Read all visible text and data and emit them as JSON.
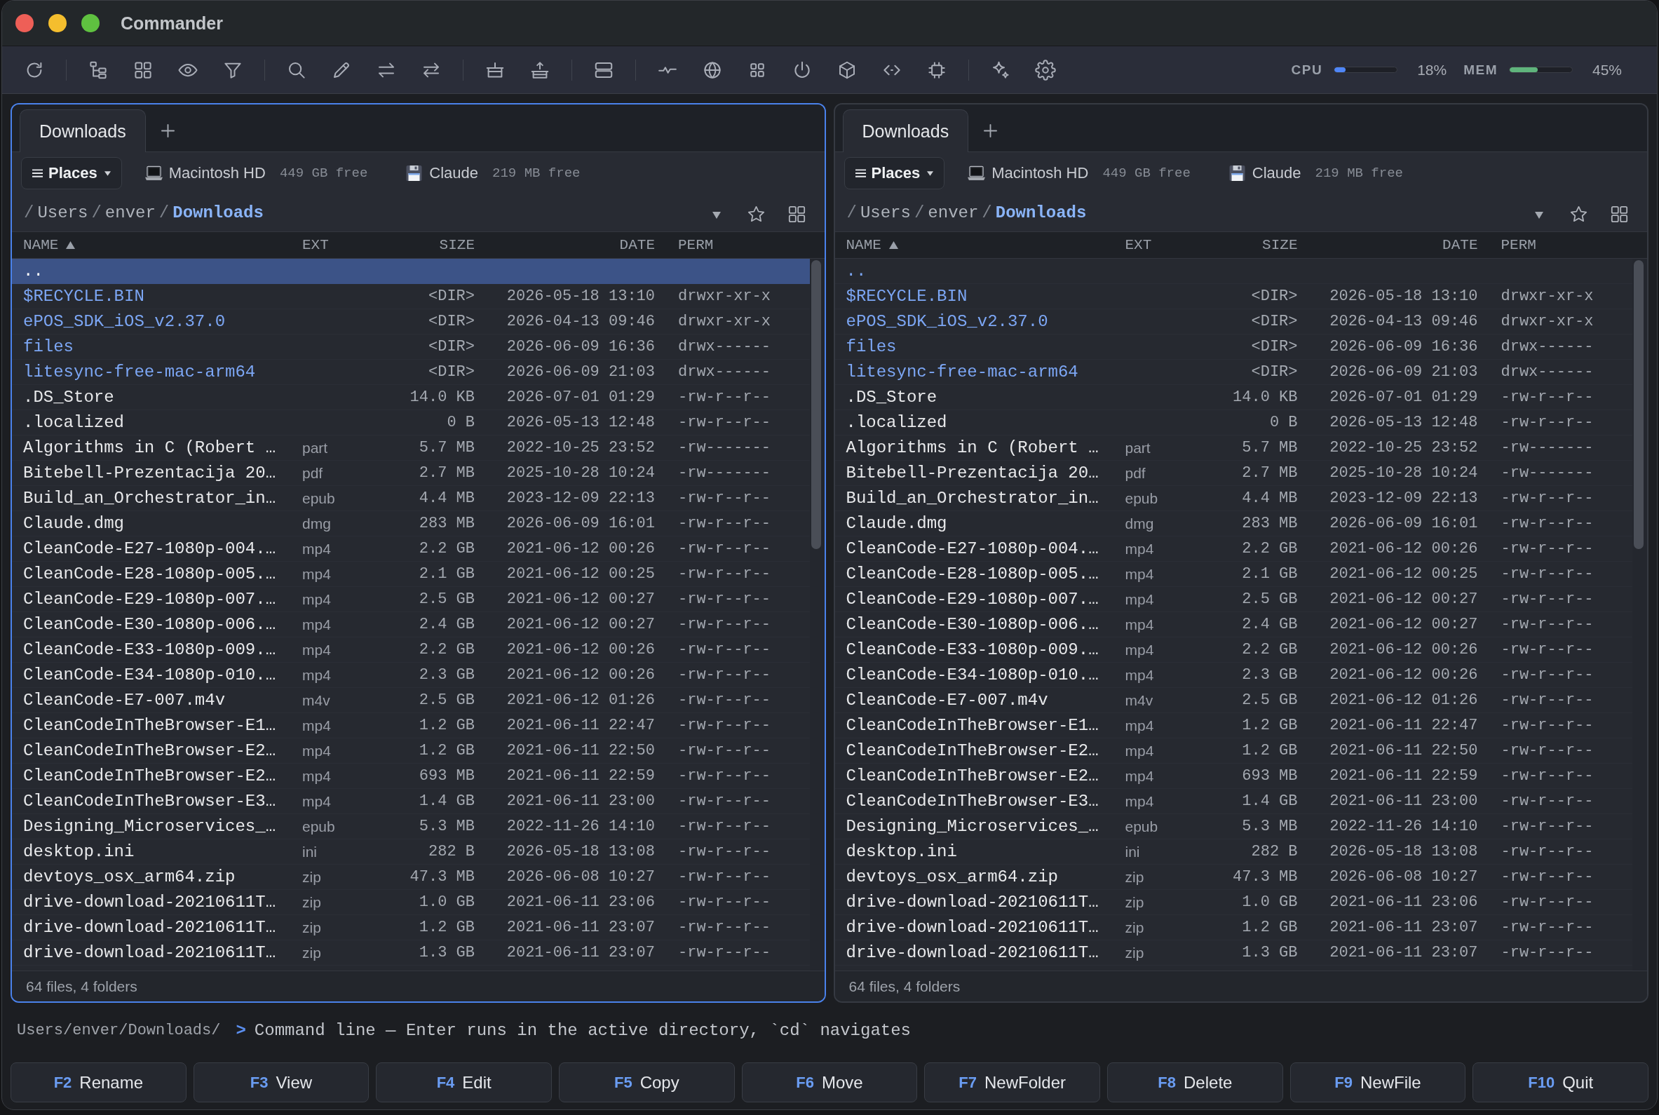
{
  "window": {
    "title": "Commander"
  },
  "meters": [
    {
      "label": "CPU",
      "level": 0.18,
      "reading": "18%",
      "color": "#4f86f7"
    },
    {
      "label": "MEM",
      "level": 0.45,
      "reading": "45%",
      "color": "#5fb47c"
    }
  ],
  "panels": [
    {
      "active": true,
      "tabs": [
        {
          "label": "Downloads",
          "selected": true
        }
      ],
      "places": "Places",
      "drives": [
        {
          "kind": "internal",
          "name": "Macintosh HD",
          "free": "449 GB free"
        },
        {
          "kind": "volume",
          "name": "Claude",
          "free": "219 MB free"
        }
      ],
      "path": [
        {
          "sep": "/",
          "name": "Users",
          "current": false
        },
        {
          "sep": "/",
          "name": "enver",
          "current": false
        },
        {
          "sep": "/",
          "name": "Downloads",
          "current": true
        }
      ],
      "columns": [
        {
          "label": "NAME",
          "sorted": true
        },
        {
          "label": "EXT",
          "sorted": false
        },
        {
          "label": "SIZE",
          "sorted": false
        },
        {
          "label": "DATE",
          "sorted": false
        },
        {
          "label": "PERM",
          "sorted": false
        }
      ],
      "rows": [
        {
          "kind": "parent",
          "name": "..",
          "selected": true
        },
        {
          "kind": "dir",
          "name": "$RECYCLE.BIN",
          "size": "<DIR>",
          "date": "2026-05-18 13:10",
          "perm": "drwxr-xr-x",
          "selected": false
        },
        {
          "kind": "dir",
          "name": "ePOS_SDK_iOS_v2.37.0",
          "size": "<DIR>",
          "date": "2026-04-13 09:46",
          "perm": "drwxr-xr-x",
          "selected": false
        },
        {
          "kind": "dir",
          "name": "files",
          "size": "<DIR>",
          "date": "2026-06-09 16:36",
          "perm": "drwx------",
          "selected": false
        },
        {
          "kind": "dir",
          "name": "litesync-free-mac-arm64",
          "size": "<DIR>",
          "date": "2026-06-09 21:03",
          "perm": "drwx------",
          "selected": false
        },
        {
          "kind": "file",
          "name": ".DS_Store",
          "size": "14.0 KB",
          "date": "2026-07-01 01:29",
          "perm": "-rw-r--r--",
          "selected": false
        },
        {
          "kind": "file",
          "name": ".localized",
          "size": "0 B",
          "date": "2026-05-13 12:48",
          "perm": "-rw-r--r--",
          "selected": false
        },
        {
          "kind": "file",
          "name": "Algorithms in C (Robert …",
          "ext": "part",
          "size": "5.7 MB",
          "date": "2022-10-25 23:52",
          "perm": "-rw-------",
          "selected": false
        },
        {
          "kind": "file",
          "name": "Bitebell-Prezentacija 20…",
          "ext": "pdf",
          "size": "2.7 MB",
          "date": "2025-10-28 10:24",
          "perm": "-rw-------",
          "selected": false
        },
        {
          "kind": "file",
          "name": "Build_an_Orchestrator_in…",
          "ext": "epub",
          "size": "4.4 MB",
          "date": "2023-12-09 22:13",
          "perm": "-rw-r--r--",
          "selected": false
        },
        {
          "kind": "file",
          "name": "Claude.dmg",
          "ext": "dmg",
          "size": "283 MB",
          "date": "2026-06-09 16:01",
          "perm": "-rw-r--r--",
          "selected": false
        },
        {
          "kind": "file",
          "name": "CleanCode-E27-1080p-004.…",
          "ext": "mp4",
          "size": "2.2 GB",
          "date": "2021-06-12 00:26",
          "perm": "-rw-r--r--",
          "selected": false
        },
        {
          "kind": "file",
          "name": "CleanCode-E28-1080p-005.…",
          "ext": "mp4",
          "size": "2.1 GB",
          "date": "2021-06-12 00:25",
          "perm": "-rw-r--r--",
          "selected": false
        },
        {
          "kind": "file",
          "name": "CleanCode-E29-1080p-007.…",
          "ext": "mp4",
          "size": "2.5 GB",
          "date": "2021-06-12 00:27",
          "perm": "-rw-r--r--",
          "selected": false
        },
        {
          "kind": "file",
          "name": "CleanCode-E30-1080p-006.…",
          "ext": "mp4",
          "size": "2.4 GB",
          "date": "2021-06-12 00:27",
          "perm": "-rw-r--r--",
          "selected": false
        },
        {
          "kind": "file",
          "name": "CleanCode-E33-1080p-009.…",
          "ext": "mp4",
          "size": "2.2 GB",
          "date": "2021-06-12 00:26",
          "perm": "-rw-r--r--",
          "selected": false
        },
        {
          "kind": "file",
          "name": "CleanCode-E34-1080p-010.…",
          "ext": "mp4",
          "size": "2.3 GB",
          "date": "2021-06-12 00:26",
          "perm": "-rw-r--r--",
          "selected": false
        },
        {
          "kind": "file",
          "name": "CleanCode-E7-007.m4v",
          "ext": "m4v",
          "size": "2.5 GB",
          "date": "2021-06-12 01:26",
          "perm": "-rw-r--r--",
          "selected": false
        },
        {
          "kind": "file",
          "name": "CleanCodeInTheBrowser-E1…",
          "ext": "mp4",
          "size": "1.2 GB",
          "date": "2021-06-11 22:47",
          "perm": "-rw-r--r--",
          "selected": false
        },
        {
          "kind": "file",
          "name": "CleanCodeInTheBrowser-E2…",
          "ext": "mp4",
          "size": "1.2 GB",
          "date": "2021-06-11 22:50",
          "perm": "-rw-r--r--",
          "selected": false
        },
        {
          "kind": "file",
          "name": "CleanCodeInTheBrowser-E2…",
          "ext": "mp4",
          "size": "693 MB",
          "date": "2021-06-11 22:59",
          "perm": "-rw-r--r--",
          "selected": false
        },
        {
          "kind": "file",
          "name": "CleanCodeInTheBrowser-E3…",
          "ext": "mp4",
          "size": "1.4 GB",
          "date": "2021-06-11 23:00",
          "perm": "-rw-r--r--",
          "selected": false
        },
        {
          "kind": "file",
          "name": "Designing_Microservices_…",
          "ext": "epub",
          "size": "5.3 MB",
          "date": "2022-11-26 14:10",
          "perm": "-rw-r--r--",
          "selected": false
        },
        {
          "kind": "file",
          "name": "desktop.ini",
          "ext": "ini",
          "size": "282 B",
          "date": "2026-05-18 13:08",
          "perm": "-rw-r--r--",
          "selected": false
        },
        {
          "kind": "file",
          "name": "devtoys_osx_arm64.zip",
          "ext": "zip",
          "size": "47.3 MB",
          "date": "2026-06-08 10:27",
          "perm": "-rw-r--r--",
          "selected": false
        },
        {
          "kind": "file",
          "name": "drive-download-20210611T…",
          "ext": "zip",
          "size": "1.0 GB",
          "date": "2021-06-11 23:06",
          "perm": "-rw-r--r--",
          "selected": false
        },
        {
          "kind": "file",
          "name": "drive-download-20210611T…",
          "ext": "zip",
          "size": "1.2 GB",
          "date": "2021-06-11 23:07",
          "perm": "-rw-r--r--",
          "selected": false
        },
        {
          "kind": "file",
          "name": "drive-download-20210611T…",
          "ext": "zip",
          "size": "1.3 GB",
          "date": "2021-06-11 23:07",
          "perm": "-rw-r--r--",
          "selected": false
        }
      ],
      "status": "64 files, 4 folders"
    },
    {
      "active": false,
      "tabs": [
        {
          "label": "Downloads",
          "selected": true
        }
      ],
      "places": "Places",
      "drives": [
        {
          "kind": "internal",
          "name": "Macintosh HD",
          "free": "449 GB free"
        },
        {
          "kind": "volume",
          "name": "Claude",
          "free": "219 MB free"
        }
      ],
      "path": [
        {
          "sep": "/",
          "name": "Users",
          "current": false
        },
        {
          "sep": "/",
          "name": "enver",
          "current": false
        },
        {
          "sep": "/",
          "name": "Downloads",
          "current": true
        }
      ],
      "columns": [
        {
          "label": "NAME",
          "sorted": true
        },
        {
          "label": "EXT",
          "sorted": false
        },
        {
          "label": "SIZE",
          "sorted": false
        },
        {
          "label": "DATE",
          "sorted": false
        },
        {
          "label": "PERM",
          "sorted": false
        }
      ],
      "rows": [
        {
          "kind": "parent",
          "name": "..",
          "selected": false
        },
        {
          "kind": "dir",
          "name": "$RECYCLE.BIN",
          "size": "<DIR>",
          "date": "2026-05-18 13:10",
          "perm": "drwxr-xr-x",
          "selected": false
        },
        {
          "kind": "dir",
          "name": "ePOS_SDK_iOS_v2.37.0",
          "size": "<DIR>",
          "date": "2026-04-13 09:46",
          "perm": "drwxr-xr-x",
          "selected": false
        },
        {
          "kind": "dir",
          "name": "files",
          "size": "<DIR>",
          "date": "2026-06-09 16:36",
          "perm": "drwx------",
          "selected": false
        },
        {
          "kind": "dir",
          "name": "litesync-free-mac-arm64",
          "size": "<DIR>",
          "date": "2026-06-09 21:03",
          "perm": "drwx------",
          "selected": false
        },
        {
          "kind": "file",
          "name": ".DS_Store",
          "size": "14.0 KB",
          "date": "2026-07-01 01:29",
          "perm": "-rw-r--r--",
          "selected": false
        },
        {
          "kind": "file",
          "name": ".localized",
          "size": "0 B",
          "date": "2026-05-13 12:48",
          "perm": "-rw-r--r--",
          "selected": false
        },
        {
          "kind": "file",
          "name": "Algorithms in C (Robert …",
          "ext": "part",
          "size": "5.7 MB",
          "date": "2022-10-25 23:52",
          "perm": "-rw-------",
          "selected": false
        },
        {
          "kind": "file",
          "name": "Bitebell-Prezentacija 20…",
          "ext": "pdf",
          "size": "2.7 MB",
          "date": "2025-10-28 10:24",
          "perm": "-rw-------",
          "selected": false
        },
        {
          "kind": "file",
          "name": "Build_an_Orchestrator_in…",
          "ext": "epub",
          "size": "4.4 MB",
          "date": "2023-12-09 22:13",
          "perm": "-rw-r--r--",
          "selected": false
        },
        {
          "kind": "file",
          "name": "Claude.dmg",
          "ext": "dmg",
          "size": "283 MB",
          "date": "2026-06-09 16:01",
          "perm": "-rw-r--r--",
          "selected": false
        },
        {
          "kind": "file",
          "name": "CleanCode-E27-1080p-004.…",
          "ext": "mp4",
          "size": "2.2 GB",
          "date": "2021-06-12 00:26",
          "perm": "-rw-r--r--",
          "selected": false
        },
        {
          "kind": "file",
          "name": "CleanCode-E28-1080p-005.…",
          "ext": "mp4",
          "size": "2.1 GB",
          "date": "2021-06-12 00:25",
          "perm": "-rw-r--r--",
          "selected": false
        },
        {
          "kind": "file",
          "name": "CleanCode-E29-1080p-007.…",
          "ext": "mp4",
          "size": "2.5 GB",
          "date": "2021-06-12 00:27",
          "perm": "-rw-r--r--",
          "selected": false
        },
        {
          "kind": "file",
          "name": "CleanCode-E30-1080p-006.…",
          "ext": "mp4",
          "size": "2.4 GB",
          "date": "2021-06-12 00:27",
          "perm": "-rw-r--r--",
          "selected": false
        },
        {
          "kind": "file",
          "name": "CleanCode-E33-1080p-009.…",
          "ext": "mp4",
          "size": "2.2 GB",
          "date": "2021-06-12 00:26",
          "perm": "-rw-r--r--",
          "selected": false
        },
        {
          "kind": "file",
          "name": "CleanCode-E34-1080p-010.…",
          "ext": "mp4",
          "size": "2.3 GB",
          "date": "2021-06-12 00:26",
          "perm": "-rw-r--r--",
          "selected": false
        },
        {
          "kind": "file",
          "name": "CleanCode-E7-007.m4v",
          "ext": "m4v",
          "size": "2.5 GB",
          "date": "2021-06-12 01:26",
          "perm": "-rw-r--r--",
          "selected": false
        },
        {
          "kind": "file",
          "name": "CleanCodeInTheBrowser-E1…",
          "ext": "mp4",
          "size": "1.2 GB",
          "date": "2021-06-11 22:47",
          "perm": "-rw-r--r--",
          "selected": false
        },
        {
          "kind": "file",
          "name": "CleanCodeInTheBrowser-E2…",
          "ext": "mp4",
          "size": "1.2 GB",
          "date": "2021-06-11 22:50",
          "perm": "-rw-r--r--",
          "selected": false
        },
        {
          "kind": "file",
          "name": "CleanCodeInTheBrowser-E2…",
          "ext": "mp4",
          "size": "693 MB",
          "date": "2021-06-11 22:59",
          "perm": "-rw-r--r--",
          "selected": false
        },
        {
          "kind": "file",
          "name": "CleanCodeInTheBrowser-E3…",
          "ext": "mp4",
          "size": "1.4 GB",
          "date": "2021-06-11 23:00",
          "perm": "-rw-r--r--",
          "selected": false
        },
        {
          "kind": "file",
          "name": "Designing_Microservices_…",
          "ext": "epub",
          "size": "5.3 MB",
          "date": "2022-11-26 14:10",
          "perm": "-rw-r--r--",
          "selected": false
        },
        {
          "kind": "file",
          "name": "desktop.ini",
          "ext": "ini",
          "size": "282 B",
          "date": "2026-05-18 13:08",
          "perm": "-rw-r--r--",
          "selected": false
        },
        {
          "kind": "file",
          "name": "devtoys_osx_arm64.zip",
          "ext": "zip",
          "size": "47.3 MB",
          "date": "2026-06-08 10:27",
          "perm": "-rw-r--r--",
          "selected": false
        },
        {
          "kind": "file",
          "name": "drive-download-20210611T…",
          "ext": "zip",
          "size": "1.0 GB",
          "date": "2021-06-11 23:06",
          "perm": "-rw-r--r--",
          "selected": false
        },
        {
          "kind": "file",
          "name": "drive-download-20210611T…",
          "ext": "zip",
          "size": "1.2 GB",
          "date": "2021-06-11 23:07",
          "perm": "-rw-r--r--",
          "selected": false
        },
        {
          "kind": "file",
          "name": "drive-download-20210611T…",
          "ext": "zip",
          "size": "1.3 GB",
          "date": "2021-06-11 23:07",
          "perm": "-rw-r--r--",
          "selected": false
        }
      ],
      "status": "64 files, 4 folders"
    }
  ],
  "command_line": {
    "path": "Users/enver/Downloads/",
    "prompt": ">",
    "placeholder": "Command line — Enter runs in the active directory, `cd` navigates"
  },
  "function_keys": [
    {
      "key": "F2",
      "label": "Rename"
    },
    {
      "key": "F3",
      "label": "View"
    },
    {
      "key": "F4",
      "label": "Edit"
    },
    {
      "key": "F5",
      "label": "Copy"
    },
    {
      "key": "F6",
      "label": "Move"
    },
    {
      "key": "F7",
      "label": "NewFolder"
    },
    {
      "key": "F8",
      "label": "Delete"
    },
    {
      "key": "F9",
      "label": "NewFile"
    },
    {
      "key": "F10",
      "label": "Quit"
    }
  ]
}
